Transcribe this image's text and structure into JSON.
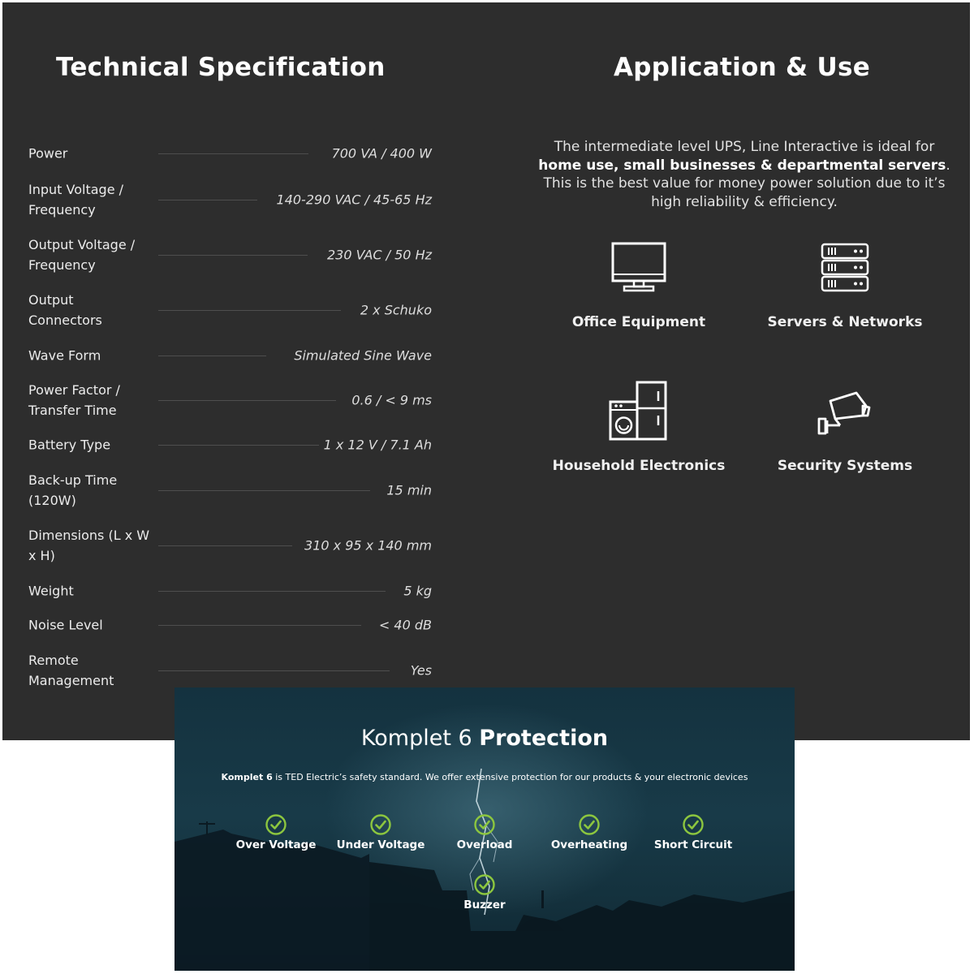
{
  "spec": {
    "title": "Technical Specification",
    "rows": [
      {
        "label": "Power",
        "value": "700 VA / 400 W"
      },
      {
        "label": "Input Voltage / Frequency",
        "value": "140-290 VAC / 45-65 Hz"
      },
      {
        "label": "Output Voltage / Frequency",
        "value": "230 VAC / 50 Hz"
      },
      {
        "label": "Output Connectors",
        "value": "2 x Schuko"
      },
      {
        "label": "Wave Form",
        "value": "Simulated Sine Wave"
      },
      {
        "label": "Power Factor / Transfer Time",
        "value": "0.6 / < 9 ms"
      },
      {
        "label": "Battery Type",
        "value": "1 x 12 V / 7.1 Ah"
      },
      {
        "label": "Back-up Time (120W)",
        "value": "15 min"
      },
      {
        "label": "Dimensions (L x W x H)",
        "value": "310 x 95 x 140 mm"
      },
      {
        "label": "Weight",
        "value": "5 kg"
      },
      {
        "label": "Noise Level",
        "value": "< 40 dB"
      },
      {
        "label": "Remote Management",
        "value": "Yes"
      }
    ]
  },
  "application": {
    "title": "Application & Use",
    "desc_part1": "The intermediate level UPS, Line Interactive is ideal for ",
    "desc_bold": "home use, small businesses & departmental servers",
    "desc_part2": ". This is the best value for money power solution due to it’s high reliability & efficiency.",
    "items": [
      {
        "label": "Office Equipment",
        "icon": "monitor-icon"
      },
      {
        "label": "Servers & Networks",
        "icon": "server-rack-icon"
      },
      {
        "label": "Household Electronics",
        "icon": "appliances-icon"
      },
      {
        "label": "Security Systems",
        "icon": "security-camera-icon"
      }
    ]
  },
  "protection": {
    "title_light": "Komplet 6",
    "title_bold": "Protection",
    "desc_bold": "Komplet 6",
    "desc_rest": " is TED Electric’s safety standard. We offer extensive protection for our products & your electronic devices",
    "features": [
      {
        "label": "Over Voltage"
      },
      {
        "label": "Under Voltage"
      },
      {
        "label": "Overload"
      },
      {
        "label": "Overheating"
      },
      {
        "label": "Short Circuit"
      },
      {
        "label": "Buzzer"
      }
    ],
    "check_color": "#8cc63f"
  }
}
